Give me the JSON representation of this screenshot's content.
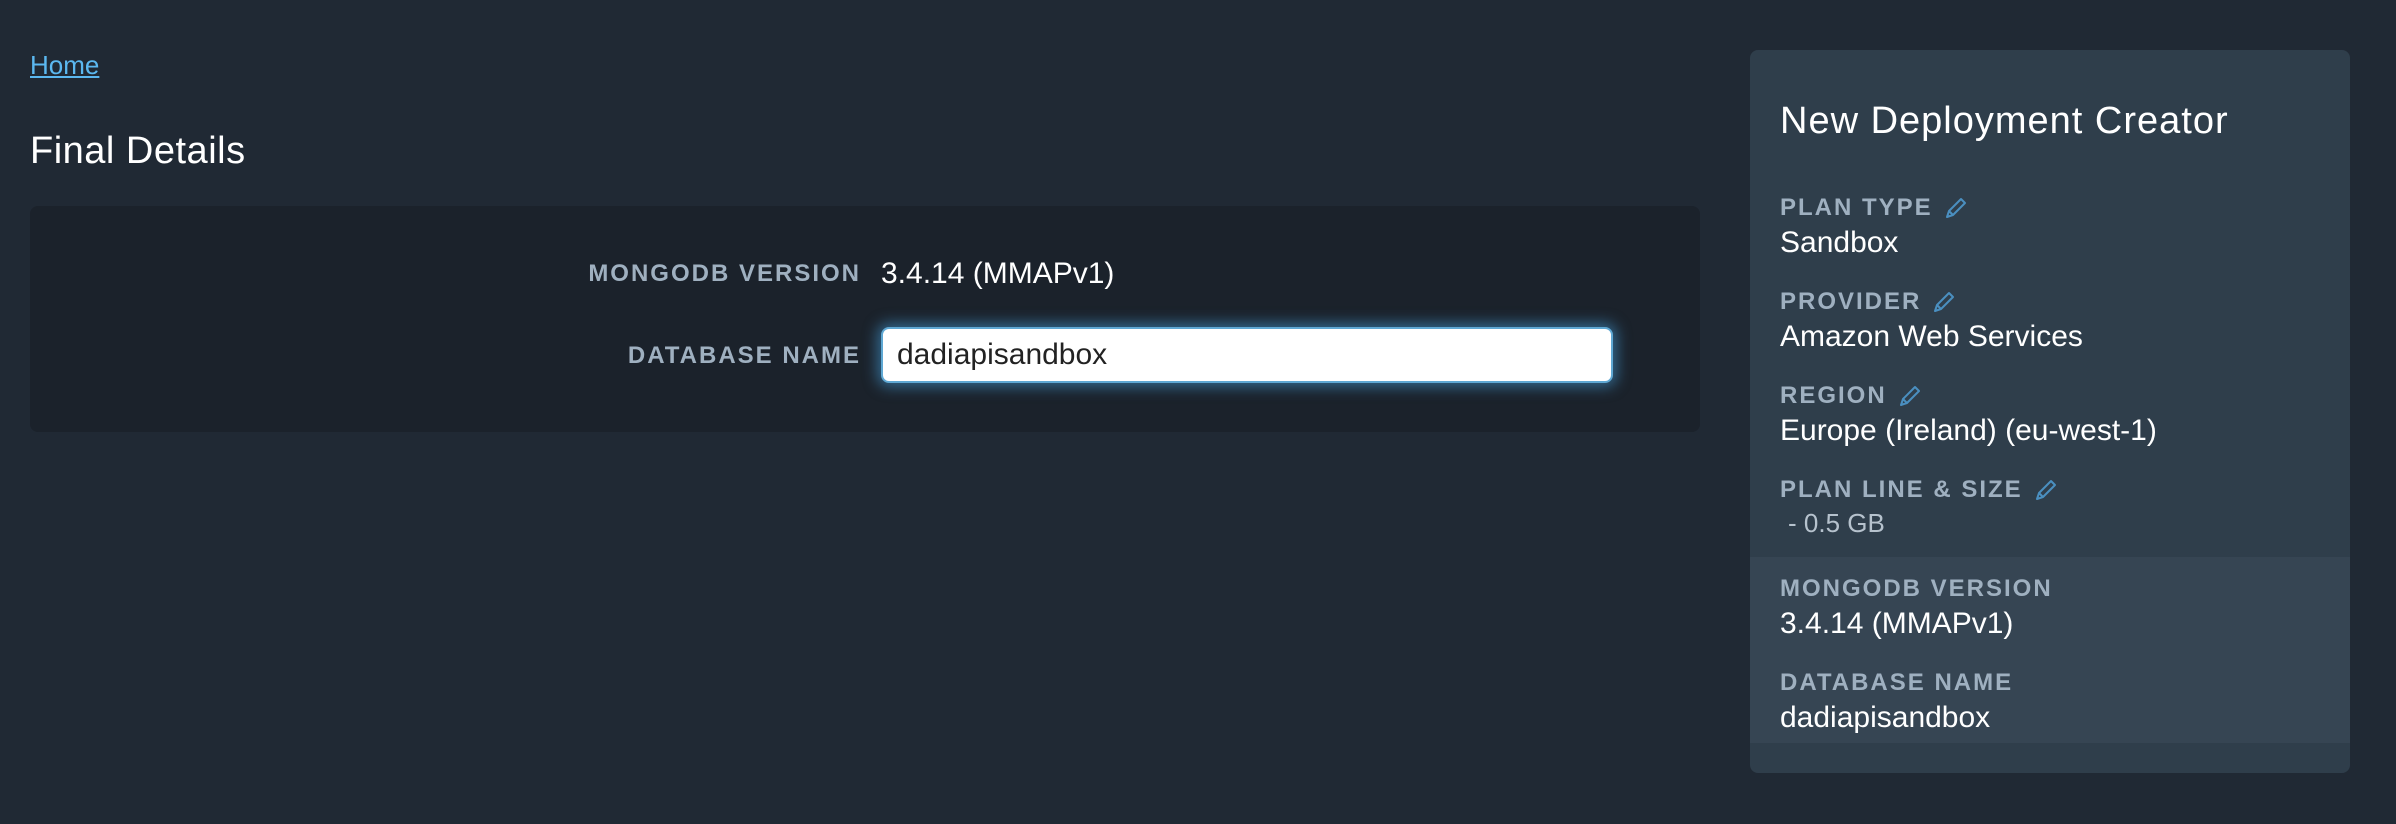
{
  "breadcrumb": {
    "home": "Home"
  },
  "page": {
    "title": "Final Details"
  },
  "form": {
    "mongodb_version_label": "MONGODB VERSION",
    "mongodb_version_value": "3.4.14 (MMAPv1)",
    "database_name_label": "DATABASE NAME",
    "database_name_value": "dadiapisandbox"
  },
  "sidebar": {
    "title": "New Deployment Creator",
    "plan_type_label": "PLAN TYPE",
    "plan_type_value": "Sandbox",
    "provider_label": "PROVIDER",
    "provider_value": "Amazon Web Services",
    "region_label": "REGION",
    "region_value": "Europe (Ireland) (eu-west-1)",
    "plan_line_label": "PLAN LINE & SIZE",
    "plan_line_value": "- 0.5 GB",
    "mongodb_version_label": "MONGODB VERSION",
    "mongodb_version_value": "3.4.14 (MMAPv1)",
    "database_name_label": "DATABASE NAME",
    "database_name_value": "dadiapisandbox"
  },
  "icons": {
    "edit": "pencil-icon"
  },
  "colors": {
    "background": "#202934",
    "card": "#1b222b",
    "sidebar": "#2f3e4b",
    "sidebar_lower": "#364553",
    "link": "#5bb8f0",
    "label": "#9fb0c0",
    "focus_glow": "#46a0dc"
  }
}
